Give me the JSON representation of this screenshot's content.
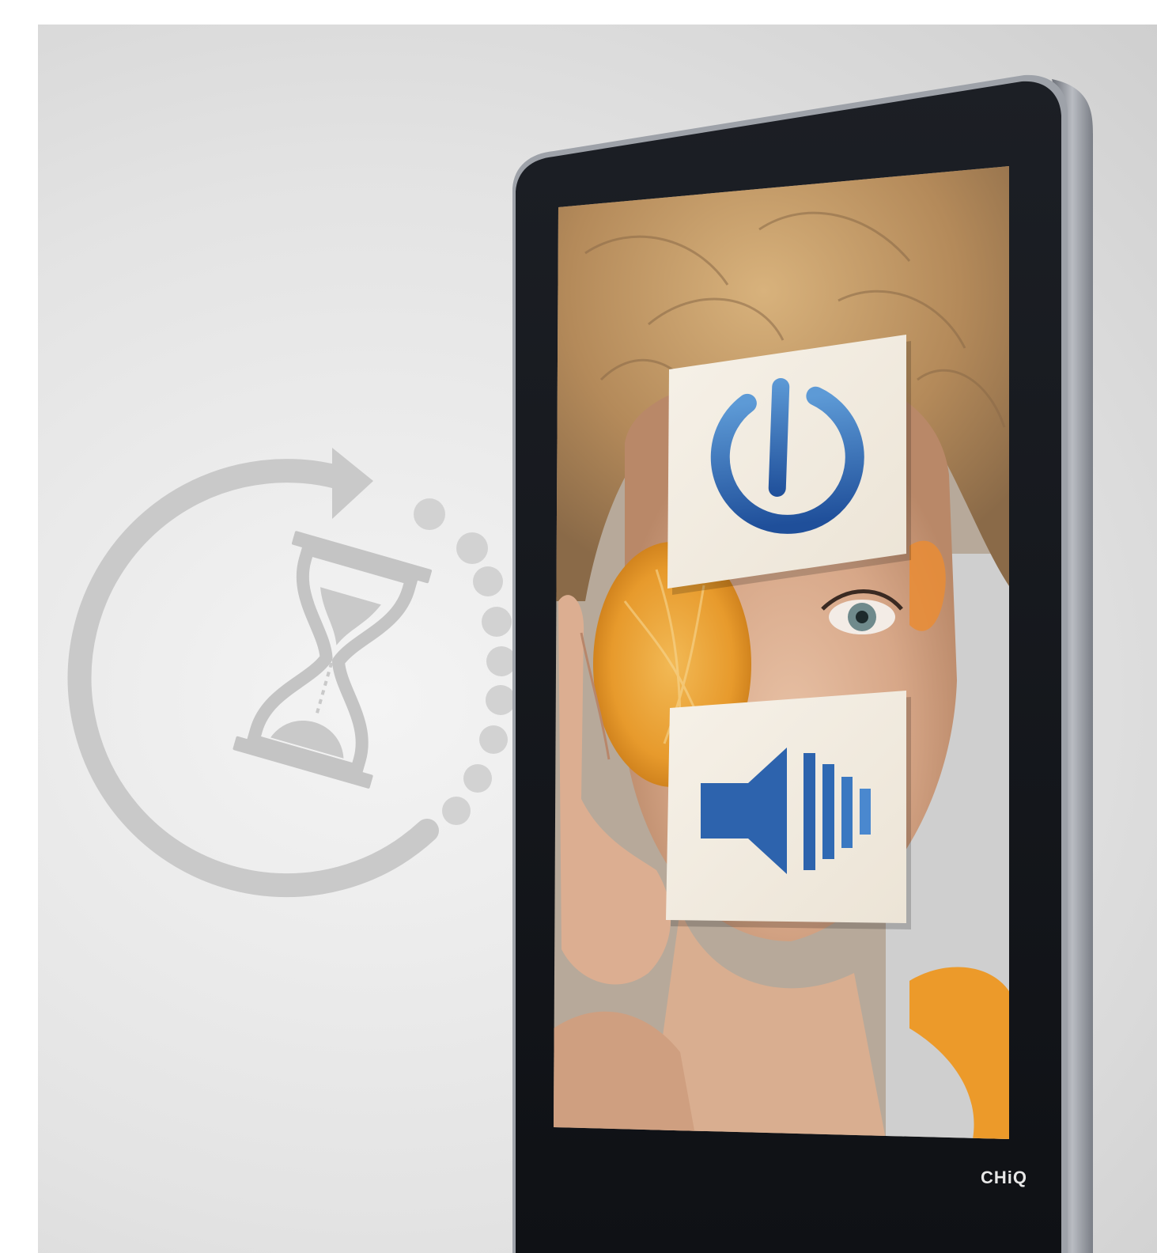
{
  "brand": {
    "label": "CHiQ"
  },
  "icons": {
    "timer": "hourglass-timer-icon",
    "power": "power-icon",
    "volume": "speaker-volume-icon"
  },
  "colors": {
    "background": "#e4e4e4",
    "bezel": "#15171c",
    "frame_edge": "#9a9ea5",
    "icon_blue": "#2d63ad",
    "timer_gray": "#c9c9c9",
    "brand_text": "#e8e8e8"
  }
}
